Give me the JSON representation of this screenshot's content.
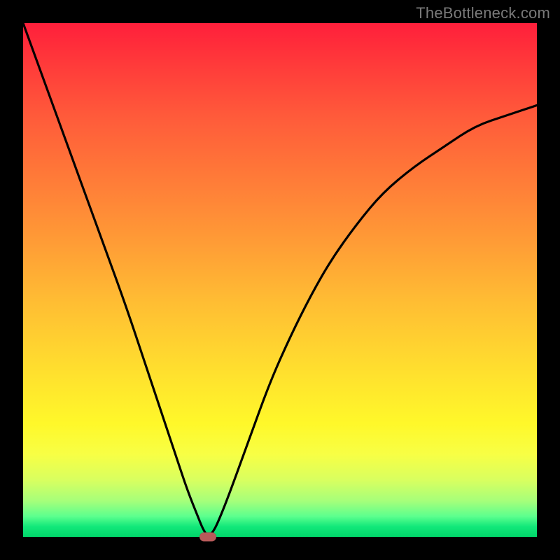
{
  "watermark": "TheBottleneck.com",
  "chart_data": {
    "type": "line",
    "title": "",
    "xlabel": "",
    "ylabel": "",
    "xlim": [
      0,
      100
    ],
    "ylim": [
      0,
      100
    ],
    "grid": false,
    "series": [
      {
        "name": "bottleneck-curve",
        "x": [
          0,
          4,
          8,
          12,
          16,
          20,
          24,
          27,
          30,
          32,
          34,
          35,
          36,
          37,
          38,
          40,
          44,
          48,
          52,
          56,
          60,
          65,
          70,
          76,
          82,
          88,
          94,
          100
        ],
        "values": [
          100,
          89,
          78,
          67,
          56,
          45,
          33,
          24,
          15,
          9,
          4,
          1.5,
          0,
          1,
          3,
          8,
          19,
          30,
          39,
          47,
          54,
          61,
          67,
          72,
          76,
          80,
          82,
          84
        ]
      }
    ],
    "marker": {
      "x": 36,
      "y": 0
    },
    "background_gradient": {
      "top": "#ff1f3b",
      "bottom": "#00d66a"
    }
  }
}
